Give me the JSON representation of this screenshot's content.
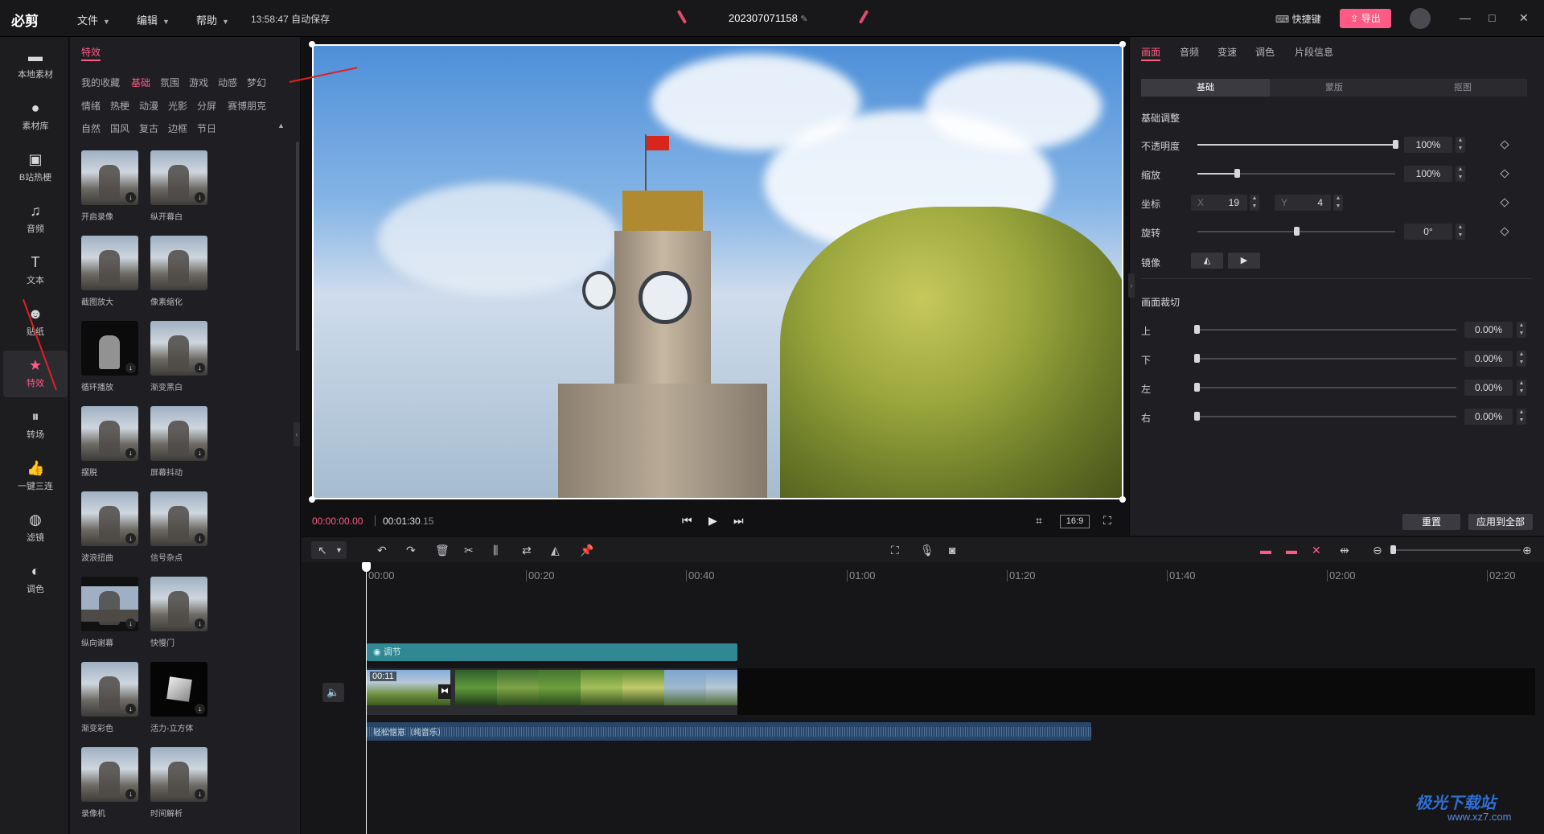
{
  "app": {
    "logo": "必剪",
    "menus": [
      "文件",
      "编辑",
      "帮助"
    ],
    "autosave_time": "13:58:47",
    "autosave_label": "自动保存",
    "project_name": "202307071158",
    "shortcut_label": "快捷键",
    "export_label": "导出"
  },
  "leftnav": [
    {
      "label": "本地素材",
      "icon": "folder-icon"
    },
    {
      "label": "素材库",
      "icon": "library-icon"
    },
    {
      "label": "B站热梗",
      "icon": "tv-icon"
    },
    {
      "label": "音频",
      "icon": "music-icon"
    },
    {
      "label": "文本",
      "icon": "text-icon"
    },
    {
      "label": "贴纸",
      "icon": "sticker-icon"
    },
    {
      "label": "特效",
      "icon": "star-icon",
      "active": true
    },
    {
      "label": "转场",
      "icon": "transition-icon"
    },
    {
      "label": "一键三连",
      "icon": "thumbsup-icon"
    },
    {
      "label": "滤镜",
      "icon": "filter-icon"
    },
    {
      "label": "调色",
      "icon": "palette-icon"
    }
  ],
  "effects": {
    "title": "特效",
    "categories": [
      [
        "我的收藏",
        "基础",
        "氛围",
        "游戏",
        "动感",
        "梦幻"
      ],
      [
        "情绪",
        "热梗",
        "动漫",
        "光影",
        "分屏",
        "赛博朋克"
      ],
      [
        "自然",
        "国风",
        "复古",
        "边框",
        "节日"
      ]
    ],
    "active_category": "基础",
    "items": [
      "开启录像",
      "纵开幕白",
      "截图放大",
      "像素缩化",
      "循环播放",
      "渐变黑白",
      "摆脱",
      "屏幕抖动",
      "波浪扭曲",
      "信号杂点",
      "纵向谢幕",
      "快慢门",
      "渐变彩色",
      "活力-立方体",
      "录像机",
      "时间解析"
    ]
  },
  "preview": {
    "current_time": "00:00:00",
    "current_frame": "00",
    "total_time": "00:01:30",
    "total_frame": "15",
    "ratio": "16:9"
  },
  "rpanel": {
    "tabs": [
      "画面",
      "音频",
      "变速",
      "调色",
      "片段信息"
    ],
    "subtabs": [
      "基础",
      "蒙版",
      "抠图"
    ],
    "basic_section": "基础调整",
    "opacity_label": "不透明度",
    "opacity_value": "100%",
    "opacity_level": 1.0,
    "scale_label": "缩放",
    "scale_value": "100%",
    "scale_level": 0.2,
    "position_label": "坐标",
    "pos_x_label": "X",
    "pos_x": "19",
    "pos_y_label": "Y",
    "pos_y": "4",
    "rotate_label": "旋转",
    "rotate_value": "0°",
    "rotate_level": 0.5,
    "mirror_label": "镜像",
    "crop_section": "画面裁切",
    "crop": [
      {
        "label": "上",
        "value": "0.00%"
      },
      {
        "label": "下",
        "value": "0.00%"
      },
      {
        "label": "左",
        "value": "0.00%"
      },
      {
        "label": "右",
        "value": "0.00%"
      }
    ],
    "reset_label": "重置",
    "apply_all_label": "应用到全部"
  },
  "timeline": {
    "ticks": [
      "00:00",
      "00:20",
      "00:40",
      "01:00",
      "01:20",
      "01:40",
      "02:00",
      "02:20"
    ],
    "adjust_label": "调节",
    "clip_duration": "00:11",
    "audio_label": "轻松惬意（纯音乐）"
  },
  "watermark": {
    "title": "极光下载站",
    "url": "www.xz7.com"
  },
  "colors": {
    "accent": "#ff5a86",
    "adjust_track": "#2f8893",
    "audio_track": "#27466a"
  }
}
